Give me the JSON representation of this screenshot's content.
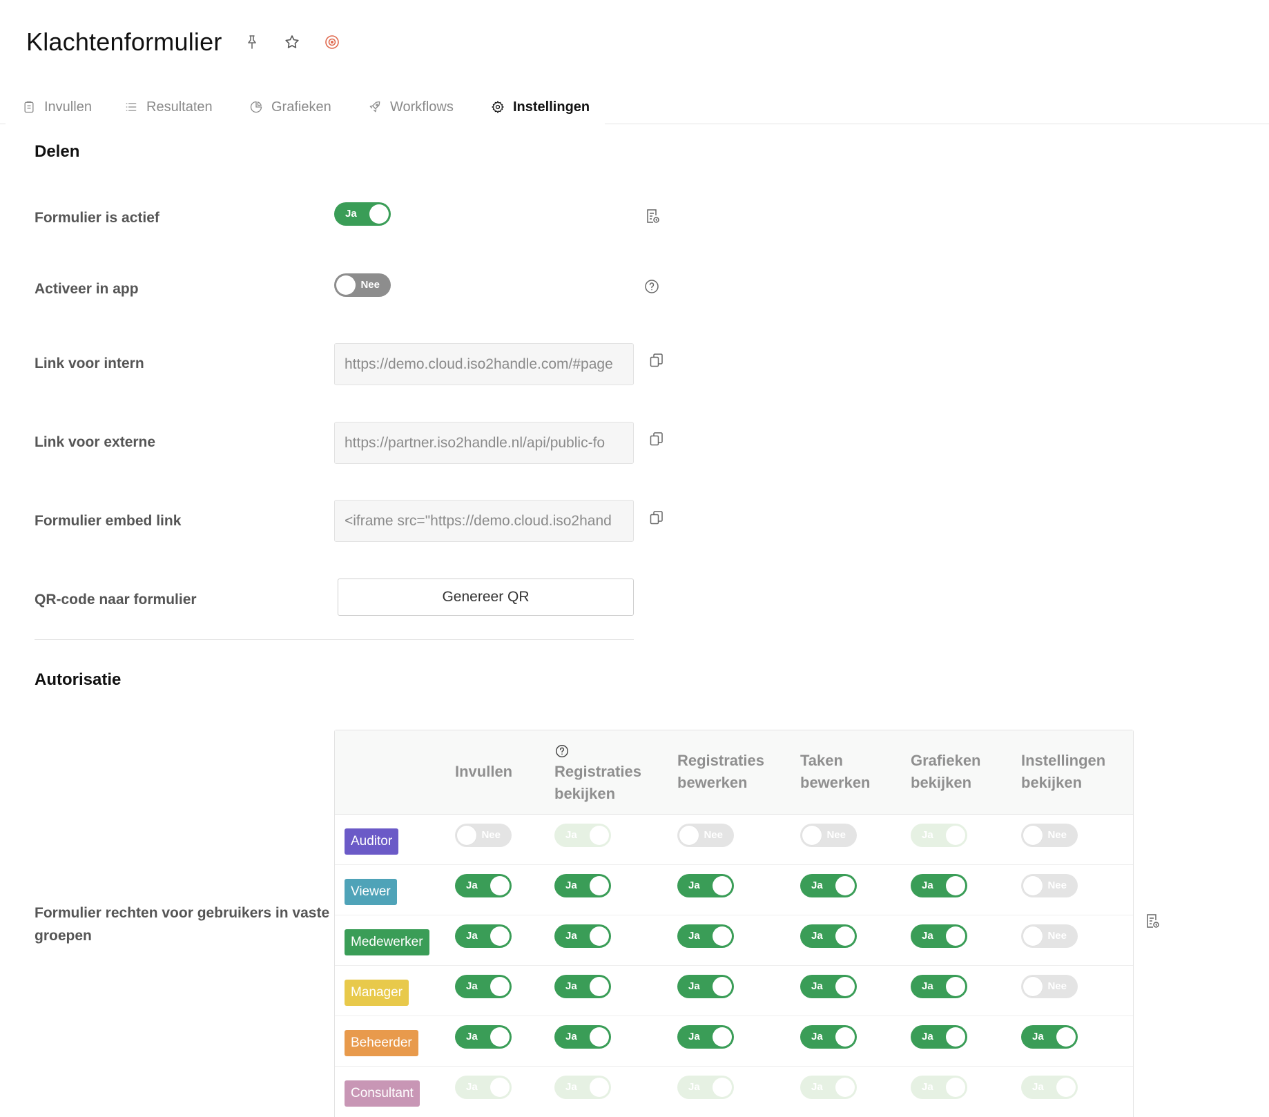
{
  "header": {
    "title": "Klachtenformulier",
    "colors": {
      "title": "#111111",
      "target_icon": "#e06a4f"
    }
  },
  "tabs": [
    {
      "label": "Invullen",
      "icon": "clipboard-icon",
      "active": false
    },
    {
      "label": "Resultaten",
      "icon": "list-icon",
      "active": false
    },
    {
      "label": "Grafieken",
      "icon": "pie-chart-icon",
      "active": false
    },
    {
      "label": "Workflows",
      "icon": "rocket-icon",
      "active": false
    },
    {
      "label": "Instellingen",
      "icon": "gear-icon",
      "active": true
    }
  ],
  "delen": {
    "title": "Delen",
    "formulier_actief": {
      "label": "Formulier is actief",
      "value": "Ja"
    },
    "activeer_app": {
      "label": "Activeer in app",
      "value": "Nee"
    },
    "link_intern": {
      "label": "Link voor intern",
      "value": "https://demo.cloud.iso2handle.com/#page"
    },
    "link_extern": {
      "label": "Link voor externe",
      "value": "https://partner.iso2handle.nl/api/public-fo"
    },
    "embed": {
      "label": "Formulier embed link",
      "value": "<iframe src=\"https://demo.cloud.iso2hand"
    },
    "qr": {
      "label": "QR-code naar formulier",
      "button": "Genereer QR"
    }
  },
  "autorisatie": {
    "title": "Autorisatie",
    "rights_label": "Formulier rechten voor gebruikers in vaste groepen",
    "columns": [
      {
        "line1": "Invullen",
        "line2": ""
      },
      {
        "line1": "Registraties",
        "line2": "bekijken",
        "help": true
      },
      {
        "line1": "Registraties",
        "line2": "bewerken"
      },
      {
        "line1": "Taken",
        "line2": "bewerken"
      },
      {
        "line1": "Grafieken",
        "line2": "bekijken"
      },
      {
        "line1": "Instellingen",
        "line2": "bekijken"
      }
    ],
    "groups": [
      {
        "name": "Auditor",
        "color": "#6b5ac7",
        "cells": [
          "off-light",
          "on-faded",
          "off-light",
          "off-light",
          "on-faded",
          "off-light"
        ]
      },
      {
        "name": "Viewer",
        "color": "#4fa3b8",
        "cells": [
          "on",
          "on",
          "on",
          "on",
          "on",
          "off-light"
        ]
      },
      {
        "name": "Medewerker",
        "color": "#3a9d57",
        "cells": [
          "on",
          "on",
          "on",
          "on",
          "on",
          "off-light"
        ]
      },
      {
        "name": "Manager",
        "color": "#e8c94b",
        "cells": [
          "on",
          "on",
          "on",
          "on",
          "on",
          "off-light"
        ]
      },
      {
        "name": "Beheerder",
        "color": "#e89a4c",
        "cells": [
          "on",
          "on",
          "on",
          "on",
          "on",
          "on"
        ]
      },
      {
        "name": "Consultant",
        "color": "#c896b5",
        "cells": [
          "on-faded",
          "on-faded",
          "on-faded",
          "on-faded",
          "on-faded",
          "on-faded"
        ]
      }
    ],
    "toggle_labels": {
      "on": "Ja",
      "off": "Nee"
    },
    "colors": {
      "on": "#3a9d57",
      "off": "#8d8d8d",
      "off_light": "#e4e4e4",
      "on_faded": "#e6f1e3"
    }
  }
}
